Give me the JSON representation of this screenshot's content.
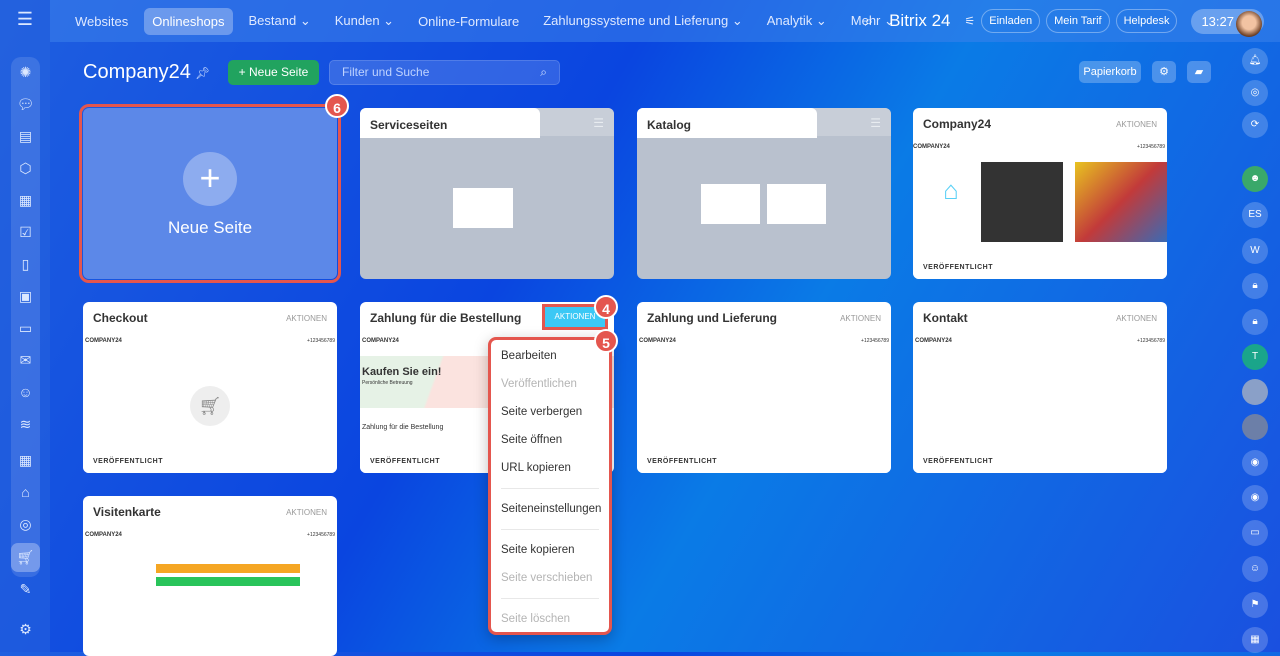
{
  "topnav": {
    "items": [
      "Websites",
      "Onlineshops",
      "Bestand ⌄",
      "Kunden ⌄",
      "Online-Formulare",
      "Zahlungssysteme und Lieferung ⌄",
      "Analytik ⌄",
      "Mehr ⌄"
    ],
    "logo": "Bitrix 24",
    "invite": "Einladen",
    "tariff": "Mein Tarif",
    "helpdesk": "Helpdesk",
    "time": "13:27"
  },
  "header": {
    "title": "Company24",
    "new_page": "+ Neue Seite",
    "search_placeholder": "Filter und Suche",
    "trash": "Papierkorb"
  },
  "new_page_card": {
    "label": "Neue Seite",
    "badge": "6"
  },
  "folders": [
    {
      "title": "Serviceseiten"
    },
    {
      "title": "Katalog"
    }
  ],
  "cards": [
    {
      "title": "Company24",
      "actions": "AKTIONEN",
      "status": "VERÖFFENTLICHT"
    },
    {
      "title": "Checkout",
      "actions": "AKTIONEN",
      "status": "VERÖFFENTLICHT"
    },
    {
      "title": "Zahlung für die Bestellung",
      "actions": "AKTIONEN",
      "status": "VERÖFFENTLICHT",
      "hero": "Kaufen Sie ein!",
      "hero_sub": "Persönliche Betreuung",
      "page_heading": "Zahlung für die Bestellung"
    },
    {
      "title": "Zahlung und Lieferung",
      "actions": "AKTIONEN",
      "status": "VERÖFFENTLICHT"
    },
    {
      "title": "Kontakt",
      "actions": "AKTIONEN",
      "status": "VERÖFFENTLICHT"
    },
    {
      "title": "Visitenkarte",
      "actions": "AKTIONEN"
    }
  ],
  "preview": {
    "company": "COMPANY24",
    "phone": "+123456789"
  },
  "badges": {
    "actions": "4",
    "menu": "5"
  },
  "menu": {
    "items": [
      "Bearbeiten",
      "Veröffentlichen",
      "Seite verbergen",
      "Seite öffnen",
      "URL kopieren",
      "Seiteneinstellungen",
      "Seite kopieren",
      "Seite verschieben",
      "Seite löschen"
    ]
  },
  "right_sidebar": {
    "initials": [
      "ES",
      "W",
      "T"
    ]
  }
}
